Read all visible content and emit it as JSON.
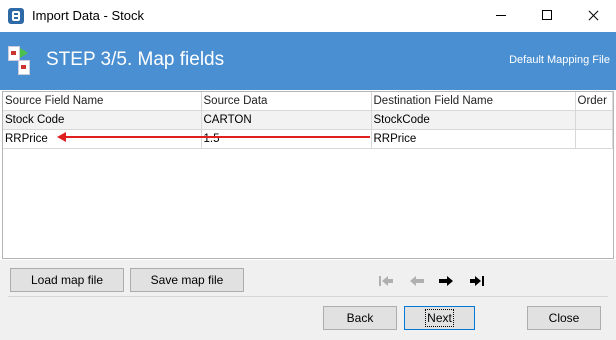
{
  "window": {
    "title": "Import Data - Stock"
  },
  "header": {
    "step_title": "STEP 3/5. Map fields",
    "default_mapping_label": "Default Mapping File"
  },
  "grid": {
    "columns": [
      "Source Field Name",
      "Source Data",
      "Destination Field Name",
      "Order"
    ],
    "rows": [
      [
        "Stock Code",
        "CARTON",
        "StockCode",
        ""
      ],
      [
        "RRPrice",
        "1.5",
        "RRPrice",
        ""
      ]
    ]
  },
  "buttons": {
    "load_map": "Load map file",
    "save_map": "Save map file",
    "back": "Back",
    "next": "Next",
    "close": "Close"
  },
  "colors": {
    "header_bg": "#4a8fd1",
    "arrow": "#e02020"
  }
}
